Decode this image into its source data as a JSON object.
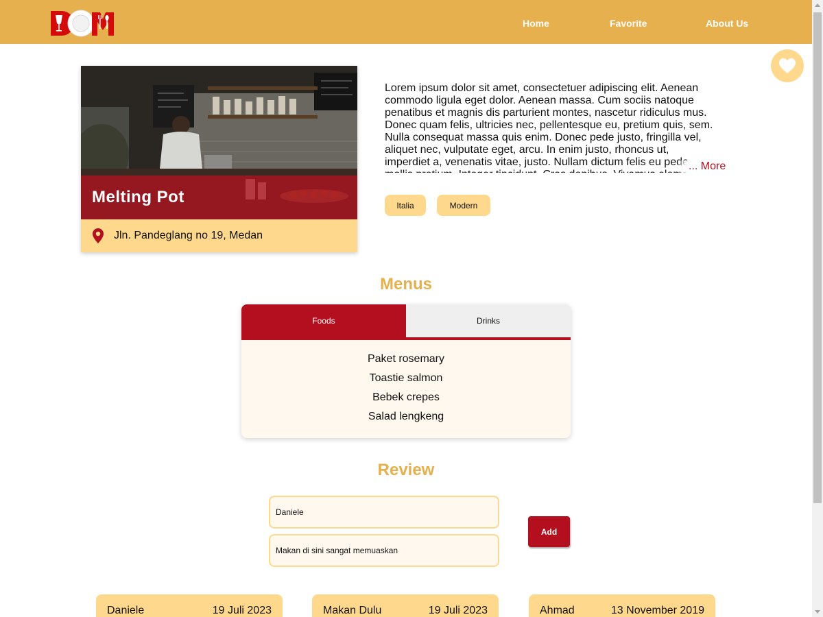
{
  "header": {
    "logo_text": "DOM",
    "nav": [
      "Home",
      "Favorite",
      "About Us"
    ]
  },
  "restaurant": {
    "name": "Melting Pot",
    "address": "Jln. Pandeglang no 19, Medan",
    "description": "Lorem ipsum dolor sit amet, consectetuer adipiscing elit. Aenean commodo ligula eget dolor. Aenean massa. Cum sociis natoque penatibus et magnis dis parturient montes, nascetur ridiculus mus. Donec quam felis, ultricies nec, pellentesque eu, pretium quis, sem. Nulla consequat massa quis enim. Donec pede justo, fringilla vel, aliquet nec, vulputate eget, arcu. In enim justo, rhoncus ut, imperdiet a, venenatis vitae, justo. Nullam dictum felis eu pede mollis pretium. Integer tincidunt. Cras dapibus. Vivamus elementum semper nisi.",
    "more_label": "... More",
    "categories": [
      "Italia",
      "Modern"
    ]
  },
  "menus": {
    "title": "Menus",
    "tabs": [
      "Foods",
      "Drinks"
    ],
    "active_tab": "Foods",
    "foods": [
      "Paket rosemary",
      "Toastie salmon",
      "Bebek crepes",
      "Salad lengkeng"
    ]
  },
  "review": {
    "title": "Review",
    "name_value": "Daniele",
    "review_value": "Makan di sini sangat memuaskan",
    "add_label": "Add",
    "items": [
      {
        "name": "Daniele",
        "date": "19 Juli 2023"
      },
      {
        "name": "Makan Dulu",
        "date": "19 Juli 2023"
      },
      {
        "name": "Ahmad",
        "date": "13 November 2019"
      }
    ]
  },
  "colors": {
    "header": "#e6b04e",
    "accent_red": "#b30f1f",
    "light_yellow": "#fed98d",
    "cream": "#fff8ee"
  },
  "icons": [
    "logo-icon",
    "heart-icon",
    "location-pin-icon"
  ]
}
